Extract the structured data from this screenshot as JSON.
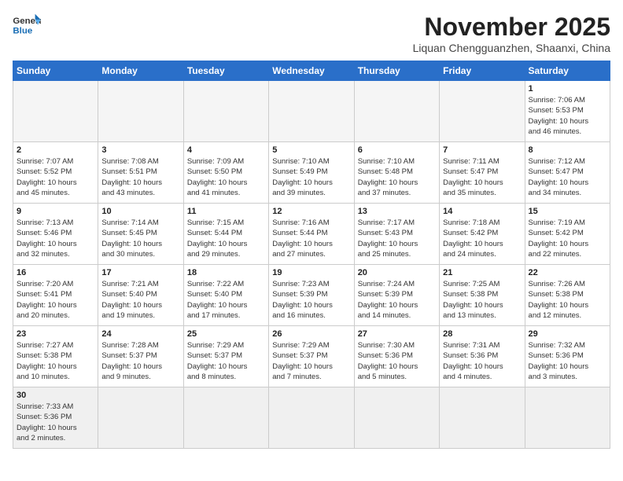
{
  "header": {
    "logo_general": "General",
    "logo_blue": "Blue",
    "month": "November 2025",
    "location": "Liquan Chengguanzhen, Shaanxi, China"
  },
  "weekdays": [
    "Sunday",
    "Monday",
    "Tuesday",
    "Wednesday",
    "Thursday",
    "Friday",
    "Saturday"
  ],
  "weeks": [
    [
      {
        "day": "",
        "info": ""
      },
      {
        "day": "",
        "info": ""
      },
      {
        "day": "",
        "info": ""
      },
      {
        "day": "",
        "info": ""
      },
      {
        "day": "",
        "info": ""
      },
      {
        "day": "",
        "info": ""
      },
      {
        "day": "1",
        "info": "Sunrise: 7:06 AM\nSunset: 5:53 PM\nDaylight: 10 hours\nand 46 minutes."
      }
    ],
    [
      {
        "day": "2",
        "info": "Sunrise: 7:07 AM\nSunset: 5:52 PM\nDaylight: 10 hours\nand 45 minutes."
      },
      {
        "day": "3",
        "info": "Sunrise: 7:08 AM\nSunset: 5:51 PM\nDaylight: 10 hours\nand 43 minutes."
      },
      {
        "day": "4",
        "info": "Sunrise: 7:09 AM\nSunset: 5:50 PM\nDaylight: 10 hours\nand 41 minutes."
      },
      {
        "day": "5",
        "info": "Sunrise: 7:10 AM\nSunset: 5:49 PM\nDaylight: 10 hours\nand 39 minutes."
      },
      {
        "day": "6",
        "info": "Sunrise: 7:10 AM\nSunset: 5:48 PM\nDaylight: 10 hours\nand 37 minutes."
      },
      {
        "day": "7",
        "info": "Sunrise: 7:11 AM\nSunset: 5:47 PM\nDaylight: 10 hours\nand 35 minutes."
      },
      {
        "day": "8",
        "info": "Sunrise: 7:12 AM\nSunset: 5:47 PM\nDaylight: 10 hours\nand 34 minutes."
      }
    ],
    [
      {
        "day": "9",
        "info": "Sunrise: 7:13 AM\nSunset: 5:46 PM\nDaylight: 10 hours\nand 32 minutes."
      },
      {
        "day": "10",
        "info": "Sunrise: 7:14 AM\nSunset: 5:45 PM\nDaylight: 10 hours\nand 30 minutes."
      },
      {
        "day": "11",
        "info": "Sunrise: 7:15 AM\nSunset: 5:44 PM\nDaylight: 10 hours\nand 29 minutes."
      },
      {
        "day": "12",
        "info": "Sunrise: 7:16 AM\nSunset: 5:44 PM\nDaylight: 10 hours\nand 27 minutes."
      },
      {
        "day": "13",
        "info": "Sunrise: 7:17 AM\nSunset: 5:43 PM\nDaylight: 10 hours\nand 25 minutes."
      },
      {
        "day": "14",
        "info": "Sunrise: 7:18 AM\nSunset: 5:42 PM\nDaylight: 10 hours\nand 24 minutes."
      },
      {
        "day": "15",
        "info": "Sunrise: 7:19 AM\nSunset: 5:42 PM\nDaylight: 10 hours\nand 22 minutes."
      }
    ],
    [
      {
        "day": "16",
        "info": "Sunrise: 7:20 AM\nSunset: 5:41 PM\nDaylight: 10 hours\nand 20 minutes."
      },
      {
        "day": "17",
        "info": "Sunrise: 7:21 AM\nSunset: 5:40 PM\nDaylight: 10 hours\nand 19 minutes."
      },
      {
        "day": "18",
        "info": "Sunrise: 7:22 AM\nSunset: 5:40 PM\nDaylight: 10 hours\nand 17 minutes."
      },
      {
        "day": "19",
        "info": "Sunrise: 7:23 AM\nSunset: 5:39 PM\nDaylight: 10 hours\nand 16 minutes."
      },
      {
        "day": "20",
        "info": "Sunrise: 7:24 AM\nSunset: 5:39 PM\nDaylight: 10 hours\nand 14 minutes."
      },
      {
        "day": "21",
        "info": "Sunrise: 7:25 AM\nSunset: 5:38 PM\nDaylight: 10 hours\nand 13 minutes."
      },
      {
        "day": "22",
        "info": "Sunrise: 7:26 AM\nSunset: 5:38 PM\nDaylight: 10 hours\nand 12 minutes."
      }
    ],
    [
      {
        "day": "23",
        "info": "Sunrise: 7:27 AM\nSunset: 5:38 PM\nDaylight: 10 hours\nand 10 minutes."
      },
      {
        "day": "24",
        "info": "Sunrise: 7:28 AM\nSunset: 5:37 PM\nDaylight: 10 hours\nand 9 minutes."
      },
      {
        "day": "25",
        "info": "Sunrise: 7:29 AM\nSunset: 5:37 PM\nDaylight: 10 hours\nand 8 minutes."
      },
      {
        "day": "26",
        "info": "Sunrise: 7:29 AM\nSunset: 5:37 PM\nDaylight: 10 hours\nand 7 minutes."
      },
      {
        "day": "27",
        "info": "Sunrise: 7:30 AM\nSunset: 5:36 PM\nDaylight: 10 hours\nand 5 minutes."
      },
      {
        "day": "28",
        "info": "Sunrise: 7:31 AM\nSunset: 5:36 PM\nDaylight: 10 hours\nand 4 minutes."
      },
      {
        "day": "29",
        "info": "Sunrise: 7:32 AM\nSunset: 5:36 PM\nDaylight: 10 hours\nand 3 minutes."
      }
    ],
    [
      {
        "day": "30",
        "info": "Sunrise: 7:33 AM\nSunset: 5:36 PM\nDaylight: 10 hours\nand 2 minutes."
      },
      {
        "day": "",
        "info": ""
      },
      {
        "day": "",
        "info": ""
      },
      {
        "day": "",
        "info": ""
      },
      {
        "day": "",
        "info": ""
      },
      {
        "day": "",
        "info": ""
      },
      {
        "day": "",
        "info": ""
      }
    ]
  ]
}
